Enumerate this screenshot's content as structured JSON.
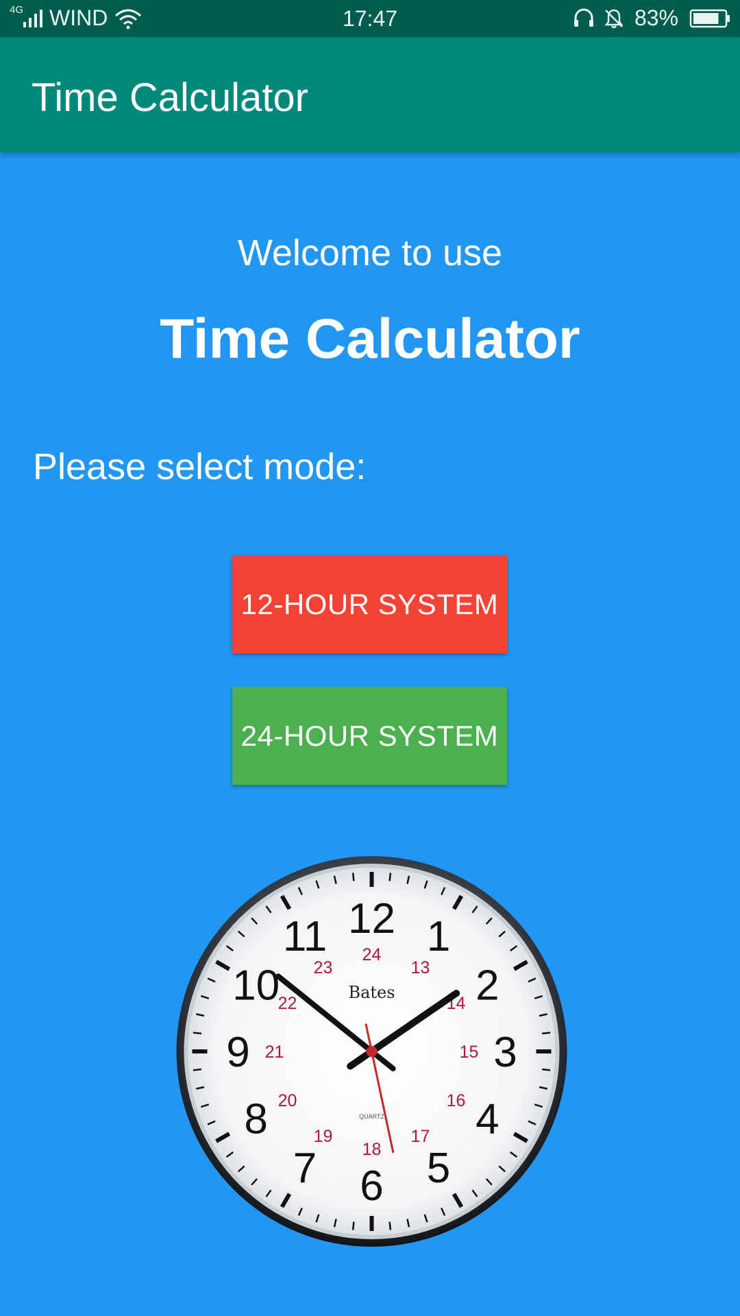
{
  "status_bar": {
    "network_type": "4G",
    "carrier": "WIND",
    "time": "17:47",
    "battery_percent": "83%",
    "battery_level": 0.83,
    "icons": [
      "signal-icon",
      "wifi-icon",
      "headset-icon",
      "mute-bell-icon",
      "battery-icon"
    ]
  },
  "app_bar": {
    "title": "Time Calculator"
  },
  "main": {
    "welcome_text": "Welcome to use",
    "headline": "Time Calculator",
    "prompt": "Please select mode:",
    "buttons": {
      "twelve_hour": "12-HOUR SYSTEM",
      "twenty_four_hour": "24-HOUR SYSTEM"
    }
  },
  "clock": {
    "brand": "Bates",
    "movement": "QUARTZ",
    "hour_numerals": [
      "12",
      "1",
      "2",
      "3",
      "4",
      "5",
      "6",
      "7",
      "8",
      "9",
      "10",
      "11"
    ],
    "inner_numerals": [
      "24",
      "13",
      "14",
      "15",
      "16",
      "17",
      "18",
      "19",
      "20",
      "21",
      "22",
      "23"
    ],
    "time_shown": "1:51:28"
  },
  "colors": {
    "background": "#2196F3",
    "status_bar": "#005C4F",
    "app_bar": "#00897B",
    "twelve_hour_button": "#F44336",
    "twenty_four_hour_button": "#4CAF50",
    "inner_numerals": "#B0173A",
    "second_hand": "#C62828"
  }
}
